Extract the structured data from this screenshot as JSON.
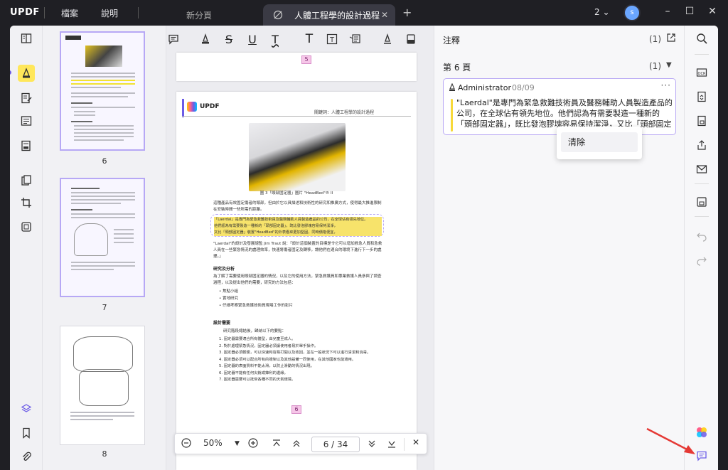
{
  "app": {
    "logo": "UPDF",
    "menu": [
      "檔案",
      "說明"
    ],
    "tabs": [
      {
        "label": "新分頁",
        "active": false
      },
      {
        "label": "人體工程學的設計過程",
        "active": true
      }
    ],
    "window_count": "2",
    "avatar_letter": "s"
  },
  "toolbar": {
    "icons": [
      "comment-icon",
      "highlighter-icon",
      "strikethrough-icon",
      "underline-icon",
      "squiggly-icon",
      "text-icon",
      "textbox-icon",
      "text-callout-icon",
      "pencil-icon",
      "eraser-icon"
    ]
  },
  "thumbnails": [
    {
      "page": "6",
      "selected": true
    },
    {
      "page": "7",
      "selected": true
    },
    {
      "page": "8",
      "selected": false
    }
  ],
  "document": {
    "badge_top": "5",
    "badge_bottom": "6",
    "logo": "UPDF",
    "header_right": "關鍵詞：人體工程學的設計過程",
    "figure_caption": "圖 3「頭部固定器」圖片 \"HeadBed\"® II",
    "para1": "這種產品有效固定傷者的頭部，但由於它以具描述和技術性的研究和推廣方式，使得最大推進限制在安裝時間一些所需的距離。",
    "highlighted_lines": [
      "「Laerdal」是專門為緊急救難技術員及醫務輔助人員製造產品的公司，在全球佔有領先地位。",
      "他們認為有需要製造一種新的「頭部固定器」，既比發泡膠塊容易保持潔淨，",
      "又比「頭部固定器」裝置\"HeadBed\"的外表看來更加堅固，同時價格便宜，"
    ],
    "para2": "\"Laerdal\"的設計及發展總監 Jim Traut 說：「設計這個裝置的目標是令它可以增加救急人員和急救人員在一些緊急情況的處理效率，快速將傷者固定及轉移，讓他們在適合的環境下進行下一步的處理。」",
    "section1_title": "研究及分析",
    "section1_text": "為了解了需要使用頭部固定器的情況，以及它的使用方法，緊急救護員和專業救護人員參與了調查過程，以及提出他們的需要，研究的方法包括：",
    "section1_bullets": [
      "焦點小組",
      "實地研究",
      "仔細考察緊急救護技術員現場工作的影片"
    ],
    "section2_title": "設計需要",
    "section2_intro": "研究階段總結後，歸納以下的要點：",
    "section2_items": [
      "固定器需要適合所有體型，由兒童至成人。",
      "對於處理緊急情況，固定器必須讓使用者易於單手操作。",
      "固定器必須輕便，可以快速和容易打開以及收回，並在一般狀況下可以進行清潔和消毒。",
      "固定器必須可以配合所有的擔架以及其他設備一同使用，在其他國家也能適用。",
      "固定器的表面質料不能太滑，以防止滑動的情況出現。",
      "固定器不能有任何尖銳或鋒利的邊緣。",
      "固定器需要可以抵受各種不同的天氣環境。"
    ]
  },
  "zoom": {
    "level": "50%",
    "current_page": "6",
    "separator": "/",
    "total_pages": "34"
  },
  "comments": {
    "title": "注釋",
    "count": "(1)",
    "page_label": "第 6 頁",
    "page_count": "(1)",
    "card": {
      "author": "Administrator",
      "date": "08/09",
      "more": "···",
      "text": "\"Laerdal\"是專門為緊急救難技術員及醫務輔助人員製造產品的公司，在全球佔有領先地位。他們認為有需要製造一種新的「頭部固定器」，既比發泡膠塊容易保持潔淨，又比「頭部固定器」裝置\"HeadBed\"的外表看來更加堅固，同時價格便宜，以便在有需要的時候可以丟棄。"
    },
    "popup_item": "清除"
  },
  "colors": {
    "accent": "#6c5ce7",
    "highlight": "#f7d93a",
    "active_tool": "#ffe75a",
    "arrow": "#e53935"
  }
}
